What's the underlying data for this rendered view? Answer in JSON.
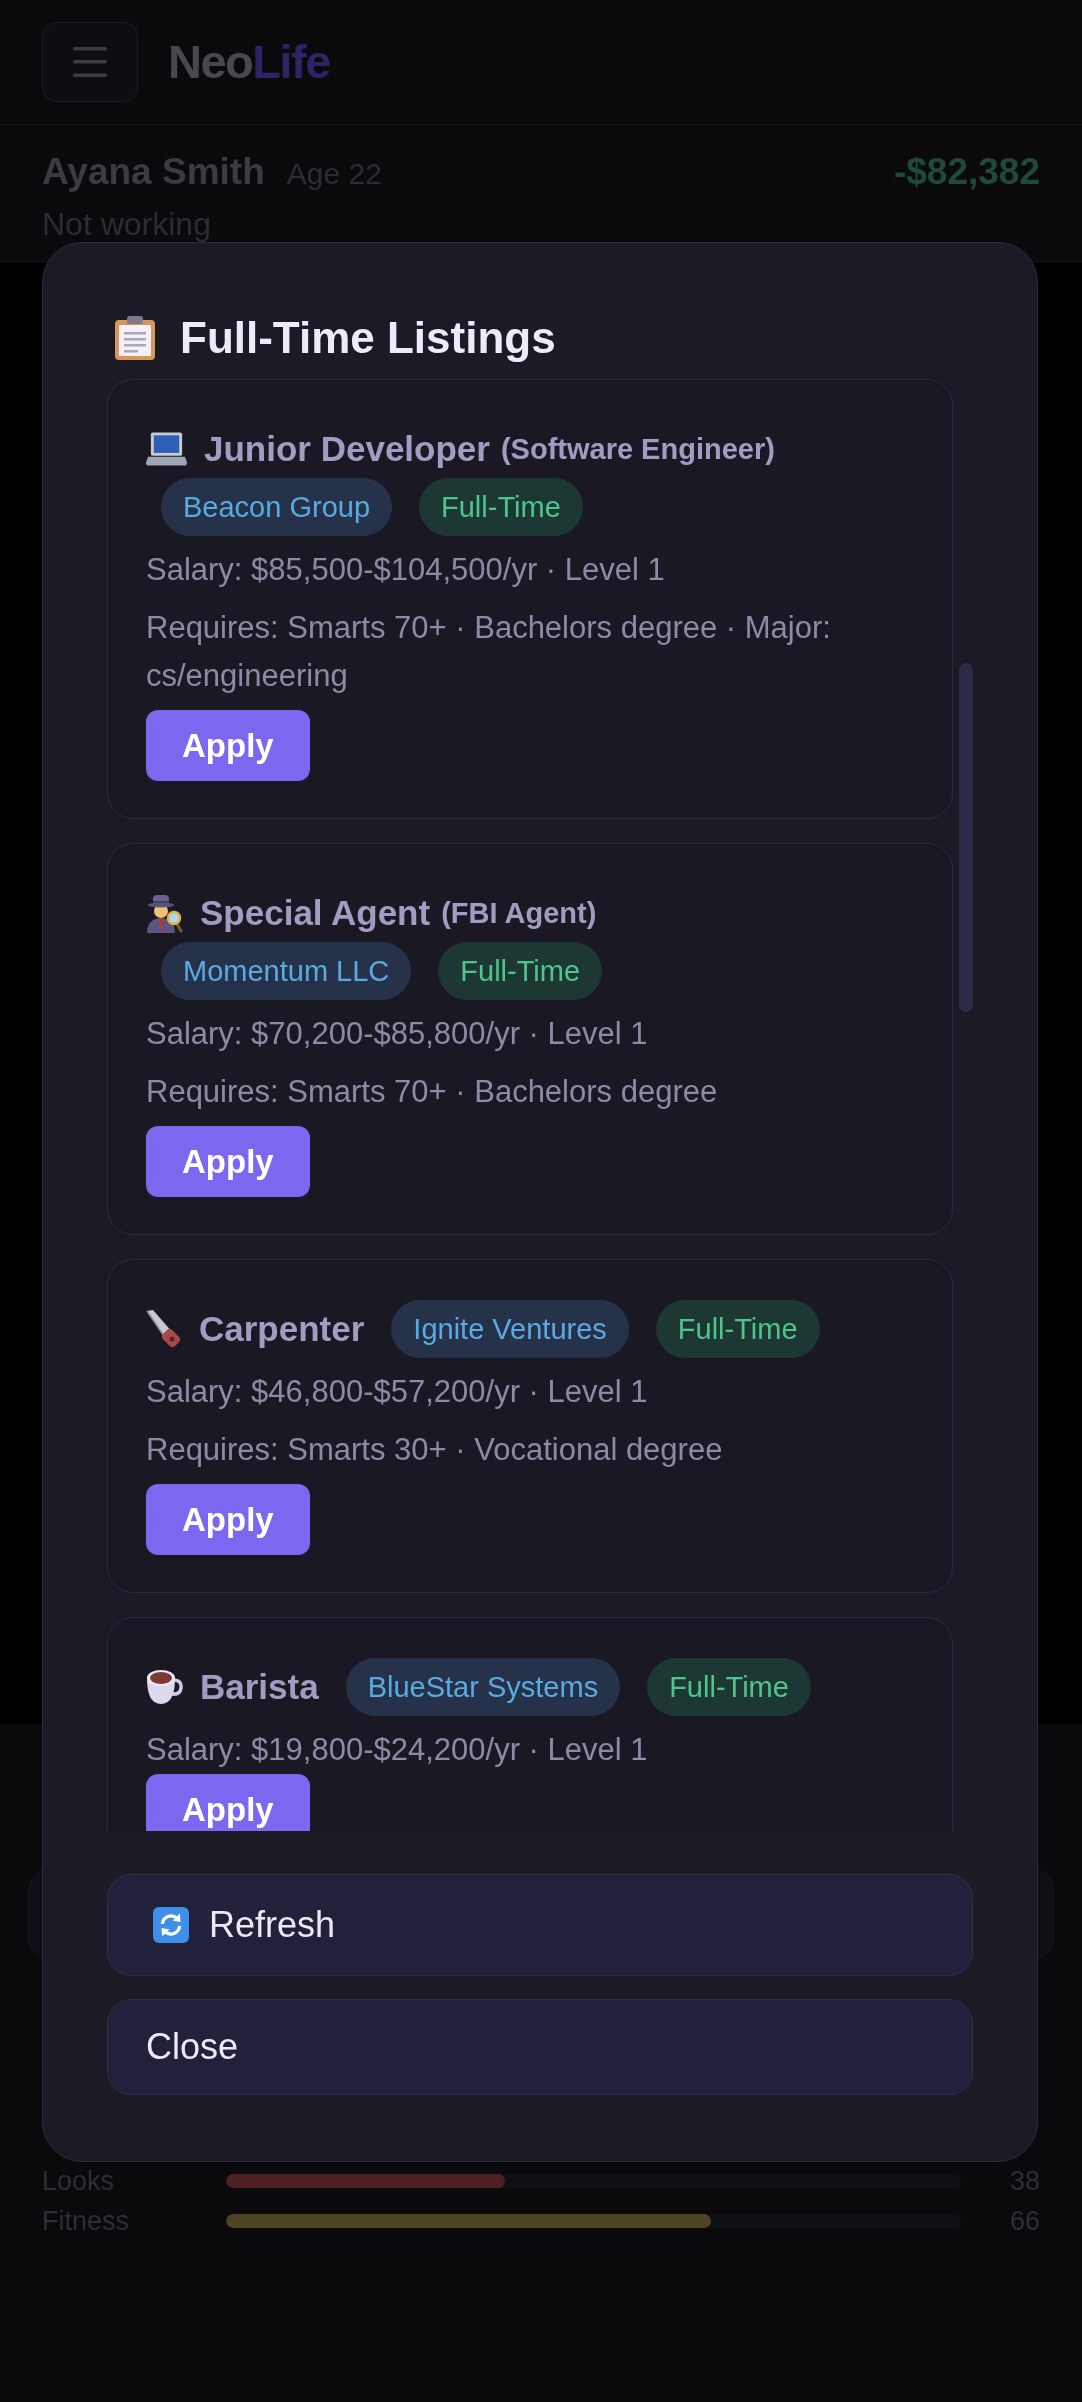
{
  "header": {
    "logo": {
      "text": "Neo",
      "accent": "Life"
    }
  },
  "profile": {
    "name": "Ayana Smith",
    "age": "Age 22",
    "balance": "-$82,382",
    "status": "Not working"
  },
  "stats": [
    {
      "label": "Looks",
      "level": 0.38,
      "value": "38",
      "color": "#4f1f23"
    },
    {
      "label": "Fitness",
      "level": 0.66,
      "value": "66",
      "color": "#4e4423"
    }
  ],
  "modal": {
    "title": "Full-Time Listings",
    "listings": [
      {
        "kind": "laptop",
        "title": "Junior Developer",
        "subtitle": "(Software Engineer)",
        "tags": [
          {
            "kind": "company",
            "label": "Beacon Group"
          },
          {
            "kind": "type",
            "label": "Full-Time"
          }
        ],
        "salary": "Salary: $85,500-$104,500/yr · Level 1",
        "requirements": "Requires: Smarts 70+ · Bachelors degree · Major: cs/engineering",
        "action": "Apply"
      },
      {
        "kind": "detective",
        "title": "Special Agent",
        "subtitle": "(FBI Agent)",
        "tags": [
          {
            "kind": "company",
            "label": "Momentum LLC"
          },
          {
            "kind": "type",
            "label": "Full-Time"
          }
        ],
        "salary": "Salary: $70,200-$85,800/yr · Level 1",
        "requirements": "Requires: Smarts 70+ · Bachelors degree",
        "action": "Apply"
      },
      {
        "kind": "saw",
        "title": "Carpenter",
        "tags": [
          {
            "kind": "company",
            "label": "Ignite Ventures"
          },
          {
            "kind": "type",
            "label": "Full-Time"
          }
        ],
        "salary": "Salary: $46,800-$57,200/yr · Level 1",
        "requirements": "Requires: Smarts 30+ · Vocational degree",
        "action": "Apply"
      },
      {
        "kind": "coffee",
        "title": "Barista",
        "tags": [
          {
            "kind": "company",
            "label": "BlueStar Systems"
          },
          {
            "kind": "type",
            "label": "Full-Time"
          }
        ],
        "salary": "Salary: $19,800-$24,200/yr · Level 1",
        "action": "Apply"
      }
    ],
    "buttons": [
      {
        "kind": "refresh",
        "label": "Refresh"
      },
      {
        "kind": "close",
        "label": "Close"
      }
    ]
  }
}
